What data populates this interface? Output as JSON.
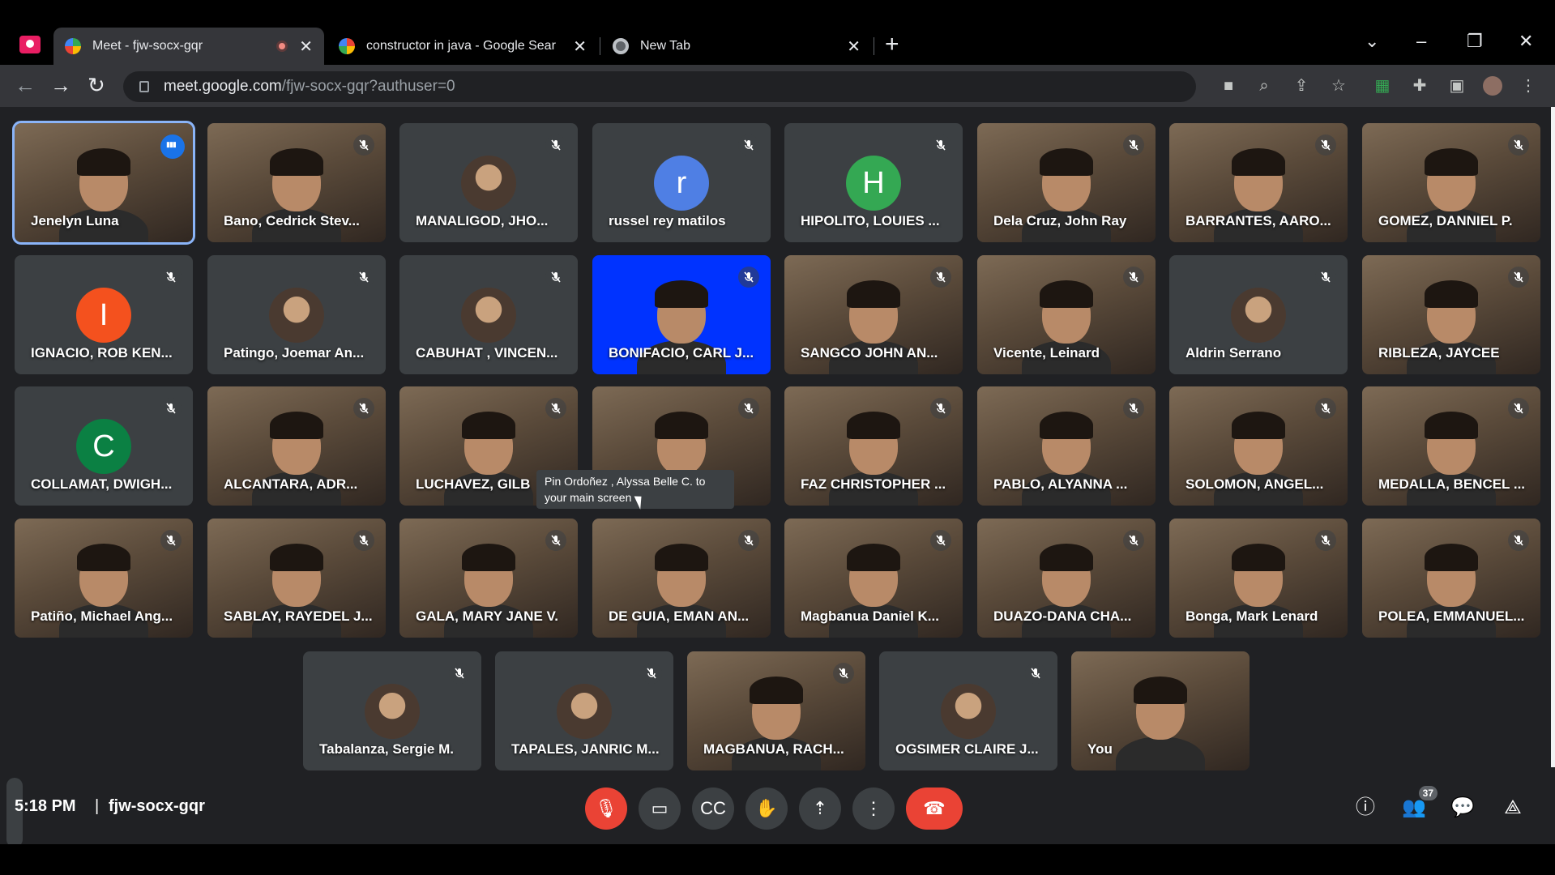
{
  "browser": {
    "tabs": [
      {
        "title": "Meet - fjw-socx-gqr",
        "active": true,
        "recording": true
      },
      {
        "title": "constructor in java - Google Sear",
        "active": false
      },
      {
        "title": "New Tab",
        "active": false
      }
    ],
    "url_host": "meet.google.com",
    "url_path": "/fjw-socx-gqr?authuser=0"
  },
  "participants_grid": [
    {
      "name": "Jenelyn Luna",
      "kind": "video",
      "speaking": true
    },
    {
      "name": "Bano, Cedrick Stev...",
      "kind": "video"
    },
    {
      "name": "MANALIGOD, JHO...",
      "kind": "photo"
    },
    {
      "name": "russel rey matilos",
      "kind": "letter",
      "letter": "r",
      "color": "#4f7fe4"
    },
    {
      "name": "HIPOLITO, LOUIES ...",
      "kind": "letter",
      "letter": "H",
      "color": "#34a853"
    },
    {
      "name": "Dela Cruz, John Ray",
      "kind": "video"
    },
    {
      "name": "BARRANTES, AARO...",
      "kind": "video"
    },
    {
      "name": "GOMEZ, DANNIEL P.",
      "kind": "video"
    },
    {
      "name": "IGNACIO, ROB KEN...",
      "kind": "letter",
      "letter": "I",
      "color": "#f4511e"
    },
    {
      "name": "Patingo, Joemar An...",
      "kind": "photo"
    },
    {
      "name": "CABUHAT , VINCEN...",
      "kind": "photo"
    },
    {
      "name": "BONIFACIO, CARL J...",
      "kind": "blue"
    },
    {
      "name": "SANGCO JOHN AN...",
      "kind": "video"
    },
    {
      "name": "Vicente, Leinard",
      "kind": "video"
    },
    {
      "name": "Aldrin Serrano",
      "kind": "photo"
    },
    {
      "name": "RIBLEZA, JAYCEE",
      "kind": "video"
    },
    {
      "name": "COLLAMAT, DWIGH...",
      "kind": "letter",
      "letter": "C",
      "color": "#0b8043"
    },
    {
      "name": "ALCANTARA, ADR...",
      "kind": "video"
    },
    {
      "name": "LUCHAVEZ, GILB",
      "kind": "video"
    },
    {
      "name": "",
      "kind": "video"
    },
    {
      "name": "FAZ CHRISTOPHER ...",
      "kind": "video"
    },
    {
      "name": "PABLO, ALYANNA ...",
      "kind": "video"
    },
    {
      "name": "SOLOMON, ANGEL...",
      "kind": "video"
    },
    {
      "name": "MEDALLA, BENCEL ...",
      "kind": "video"
    },
    {
      "name": "Patiño, Michael Ang...",
      "kind": "video"
    },
    {
      "name": "SABLAY, RAYEDEL J...",
      "kind": "video"
    },
    {
      "name": "GALA, MARY JANE V.",
      "kind": "video"
    },
    {
      "name": "DE GUIA, EMAN AN...",
      "kind": "video"
    },
    {
      "name": "Magbanua Daniel K...",
      "kind": "video"
    },
    {
      "name": "DUAZO-DANA CHA...",
      "kind": "video"
    },
    {
      "name": "Bonga, Mark Lenard",
      "kind": "video"
    },
    {
      "name": "POLEA, EMMANUEL...",
      "kind": "video"
    },
    {
      "name": "Tabalanza, Sergie M.",
      "kind": "photo"
    },
    {
      "name": "TAPALES, JANRIC M...",
      "kind": "photo"
    },
    {
      "name": "MAGBANUA, RACH...",
      "kind": "video"
    },
    {
      "name": "OGSIMER CLAIRE J...",
      "kind": "photo"
    },
    {
      "name": "You",
      "kind": "self"
    }
  ],
  "tooltip": {
    "text": "Pin Ordoñez , Alyssa Belle C. to your main screen"
  },
  "bottom": {
    "time": "5:18 PM",
    "separator": "|",
    "meeting_code": "fjw-socx-gqr",
    "people_count": "37"
  }
}
